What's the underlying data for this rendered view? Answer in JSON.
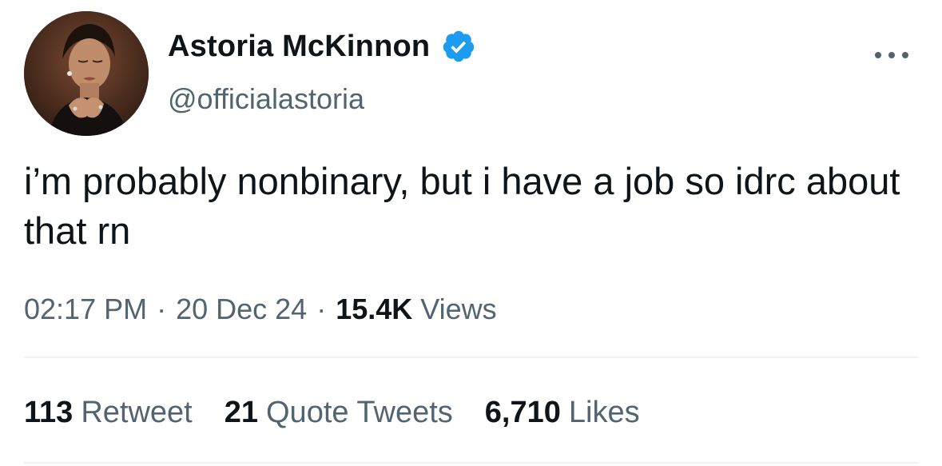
{
  "author": {
    "display_name": "Astoria McKinnon",
    "handle": "@officialastoria",
    "verified": true,
    "avatar_icon": "profile-photo"
  },
  "tweet": {
    "text": "i’m probably nonbinary, but i have a job so idrc about that rn"
  },
  "meta": {
    "time": "02:17 PM",
    "separator": "·",
    "date": "20 Dec 24",
    "views_count": "15.4K",
    "views_label": "Views"
  },
  "stats": {
    "retweets": {
      "count": "113",
      "label": "Retweet"
    },
    "quotes": {
      "count": "21",
      "label": "Quote Tweets"
    },
    "likes": {
      "count": "6,710",
      "label": "Likes"
    }
  },
  "colors": {
    "text_primary": "#0f1419",
    "text_secondary": "#536471",
    "verified_blue": "#1d9bf0",
    "divider": "#eff3f4"
  }
}
